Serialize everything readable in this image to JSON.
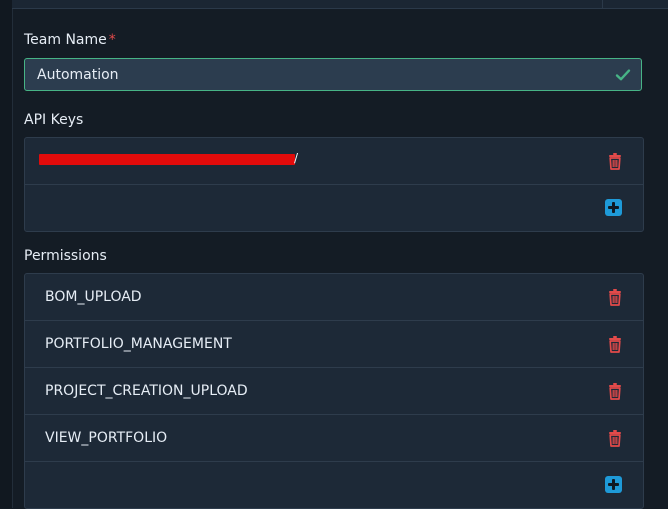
{
  "team": {
    "label": "Team Name",
    "required": "*",
    "value": "Automation"
  },
  "api_keys": {
    "label": "API Keys",
    "items": [
      {
        "value": "/"
      }
    ]
  },
  "permissions": {
    "label": "Permissions",
    "items": [
      {
        "label": "BOM_UPLOAD"
      },
      {
        "label": "PORTFOLIO_MANAGEMENT"
      },
      {
        "label": "PROJECT_CREATION_UPLOAD"
      },
      {
        "label": "VIEW_PORTFOLIO"
      }
    ]
  },
  "colors": {
    "background": "#141c25",
    "panel": "#1d2937",
    "input": "#2c3d4f",
    "success": "#47b486",
    "danger": "#e24a4a",
    "accent": "#1e9ad8",
    "redaction": "#e20b0b"
  },
  "icons": {
    "validation": "check-icon",
    "delete": "trash-icon",
    "add": "plus-square-icon"
  }
}
